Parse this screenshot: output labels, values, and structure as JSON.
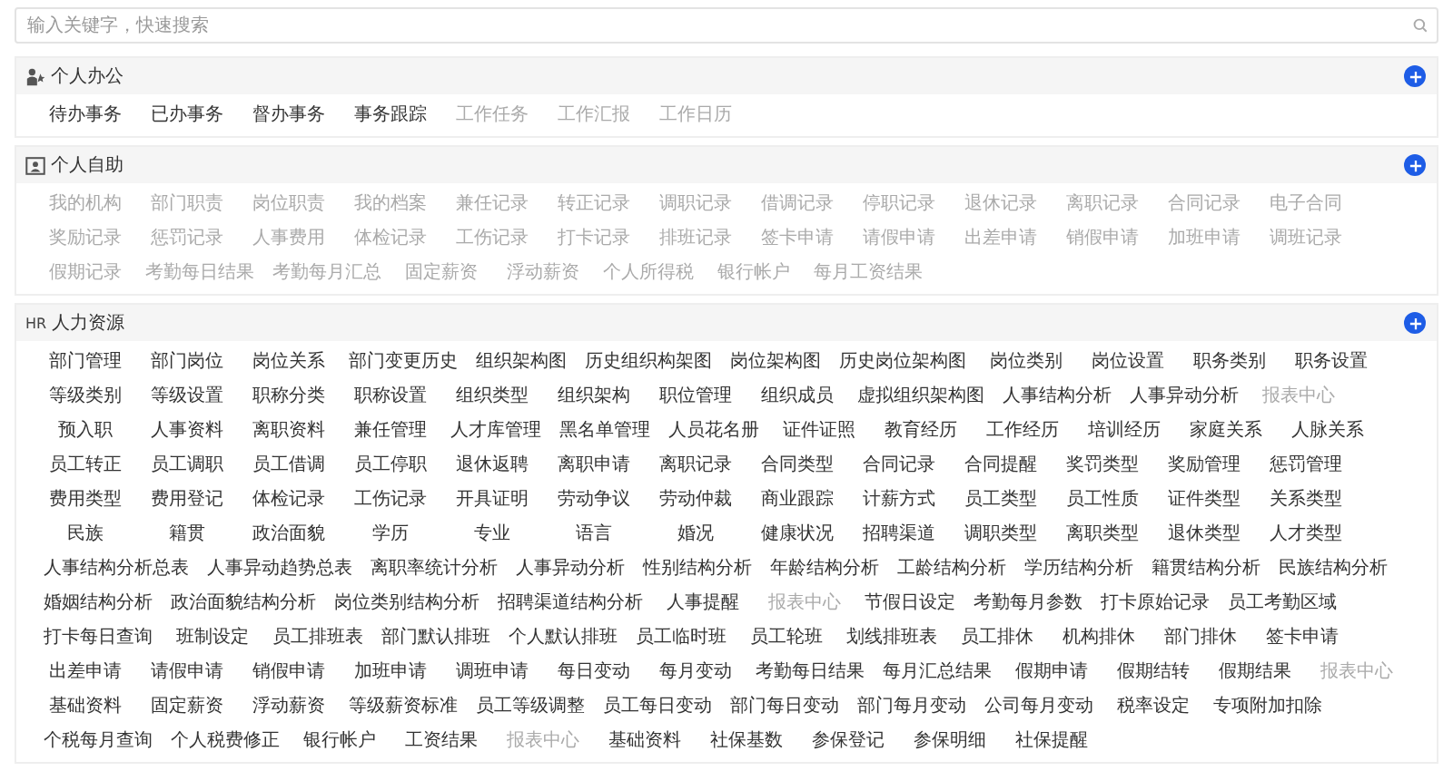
{
  "search": {
    "placeholder": "输入关键字，快速搜索"
  },
  "sections": [
    {
      "title": "个人办公",
      "kind": "person",
      "items": [
        {
          "label": "待办事务",
          "disabled": false
        },
        {
          "label": "已办事务",
          "disabled": false
        },
        {
          "label": "督办事务",
          "disabled": false
        },
        {
          "label": "事务跟踪",
          "disabled": false
        },
        {
          "label": "工作任务",
          "disabled": true
        },
        {
          "label": "工作汇报",
          "disabled": true
        },
        {
          "label": "工作日历",
          "disabled": true
        }
      ]
    },
    {
      "title": "个人自助",
      "kind": "card",
      "items": [
        {
          "label": "我的机构",
          "disabled": true
        },
        {
          "label": "部门职责",
          "disabled": true
        },
        {
          "label": "岗位职责",
          "disabled": true
        },
        {
          "label": "我的档案",
          "disabled": true
        },
        {
          "label": "兼任记录",
          "disabled": true
        },
        {
          "label": "转正记录",
          "disabled": true
        },
        {
          "label": "调职记录",
          "disabled": true
        },
        {
          "label": "借调记录",
          "disabled": true
        },
        {
          "label": "停职记录",
          "disabled": true
        },
        {
          "label": "退休记录",
          "disabled": true
        },
        {
          "label": "离职记录",
          "disabled": true
        },
        {
          "label": "合同记录",
          "disabled": true
        },
        {
          "label": "电子合同",
          "disabled": true
        },
        {
          "label": "奖励记录",
          "disabled": true
        },
        {
          "label": "惩罚记录",
          "disabled": true
        },
        {
          "label": "人事费用",
          "disabled": true
        },
        {
          "label": "体检记录",
          "disabled": true
        },
        {
          "label": "工伤记录",
          "disabled": true
        },
        {
          "label": "打卡记录",
          "disabled": true
        },
        {
          "label": "排班记录",
          "disabled": true
        },
        {
          "label": "签卡申请",
          "disabled": true
        },
        {
          "label": "请假申请",
          "disabled": true
        },
        {
          "label": "出差申请",
          "disabled": true
        },
        {
          "label": "销假申请",
          "disabled": true
        },
        {
          "label": "加班申请",
          "disabled": true
        },
        {
          "label": "调班记录",
          "disabled": true
        },
        {
          "label": "假期记录",
          "disabled": true
        },
        {
          "label": "考勤每日结果",
          "disabled": true
        },
        {
          "label": "考勤每月汇总",
          "disabled": true
        },
        {
          "label": "固定薪资",
          "disabled": true
        },
        {
          "label": "浮动薪资",
          "disabled": true
        },
        {
          "label": "个人所得税",
          "disabled": true
        },
        {
          "label": "银行帐户",
          "disabled": true
        },
        {
          "label": "每月工资结果",
          "disabled": true
        }
      ]
    },
    {
      "title": "人力资源",
      "kind": "text",
      "icon_text": "HR",
      "items": [
        {
          "label": "部门管理",
          "disabled": false
        },
        {
          "label": "部门岗位",
          "disabled": false
        },
        {
          "label": "岗位关系",
          "disabled": false
        },
        {
          "label": "部门变更历史",
          "disabled": false
        },
        {
          "label": "组织架构图",
          "disabled": false
        },
        {
          "label": "历史组织构架图",
          "disabled": false
        },
        {
          "label": "岗位架构图",
          "disabled": false
        },
        {
          "label": "历史岗位架构图",
          "disabled": false
        },
        {
          "label": "岗位类别",
          "disabled": false
        },
        {
          "label": "岗位设置",
          "disabled": false
        },
        {
          "label": "职务类别",
          "disabled": false
        },
        {
          "label": "职务设置",
          "disabled": false
        },
        {
          "label": "等级类别",
          "disabled": false
        },
        {
          "label": "等级设置",
          "disabled": false
        },
        {
          "label": "职称分类",
          "disabled": false
        },
        {
          "label": "职称设置",
          "disabled": false
        },
        {
          "label": "组织类型",
          "disabled": false
        },
        {
          "label": "组织架构",
          "disabled": false
        },
        {
          "label": "职位管理",
          "disabled": false
        },
        {
          "label": "组织成员",
          "disabled": false
        },
        {
          "label": "虚拟组织架构图",
          "disabled": false
        },
        {
          "label": "人事结构分析",
          "disabled": false
        },
        {
          "label": "人事异动分析",
          "disabled": false
        },
        {
          "label": "报表中心",
          "disabled": true
        },
        {
          "label": "预入职",
          "disabled": false
        },
        {
          "label": "人事资料",
          "disabled": false
        },
        {
          "label": "离职资料",
          "disabled": false
        },
        {
          "label": "兼任管理",
          "disabled": false
        },
        {
          "label": "人才库管理",
          "disabled": false
        },
        {
          "label": "黑名单管理",
          "disabled": false
        },
        {
          "label": "人员花名册",
          "disabled": false
        },
        {
          "label": "证件证照",
          "disabled": false
        },
        {
          "label": "教育经历",
          "disabled": false
        },
        {
          "label": "工作经历",
          "disabled": false
        },
        {
          "label": "培训经历",
          "disabled": false
        },
        {
          "label": "家庭关系",
          "disabled": false
        },
        {
          "label": "人脉关系",
          "disabled": false
        },
        {
          "label": "员工转正",
          "disabled": false
        },
        {
          "label": "员工调职",
          "disabled": false
        },
        {
          "label": "员工借调",
          "disabled": false
        },
        {
          "label": "员工停职",
          "disabled": false
        },
        {
          "label": "退休返聘",
          "disabled": false
        },
        {
          "label": "离职申请",
          "disabled": false
        },
        {
          "label": "离职记录",
          "disabled": false
        },
        {
          "label": "合同类型",
          "disabled": false
        },
        {
          "label": "合同记录",
          "disabled": false
        },
        {
          "label": "合同提醒",
          "disabled": false
        },
        {
          "label": "奖罚类型",
          "disabled": false
        },
        {
          "label": "奖励管理",
          "disabled": false
        },
        {
          "label": "惩罚管理",
          "disabled": false
        },
        {
          "label": "费用类型",
          "disabled": false
        },
        {
          "label": "费用登记",
          "disabled": false
        },
        {
          "label": "体检记录",
          "disabled": false
        },
        {
          "label": "工伤记录",
          "disabled": false
        },
        {
          "label": "开具证明",
          "disabled": false
        },
        {
          "label": "劳动争议",
          "disabled": false
        },
        {
          "label": "劳动仲裁",
          "disabled": false
        },
        {
          "label": "商业跟踪",
          "disabled": false
        },
        {
          "label": "计薪方式",
          "disabled": false
        },
        {
          "label": "员工类型",
          "disabled": false
        },
        {
          "label": "员工性质",
          "disabled": false
        },
        {
          "label": "证件类型",
          "disabled": false
        },
        {
          "label": "关系类型",
          "disabled": false
        },
        {
          "label": "民族",
          "disabled": false
        },
        {
          "label": "籍贯",
          "disabled": false
        },
        {
          "label": "政治面貌",
          "disabled": false
        },
        {
          "label": "学历",
          "disabled": false
        },
        {
          "label": "专业",
          "disabled": false
        },
        {
          "label": "语言",
          "disabled": false
        },
        {
          "label": "婚况",
          "disabled": false
        },
        {
          "label": "健康状况",
          "disabled": false
        },
        {
          "label": "招聘渠道",
          "disabled": false
        },
        {
          "label": "调职类型",
          "disabled": false
        },
        {
          "label": "离职类型",
          "disabled": false
        },
        {
          "label": "退休类型",
          "disabled": false
        },
        {
          "label": "人才类型",
          "disabled": false
        },
        {
          "label": "人事结构分析总表",
          "disabled": false
        },
        {
          "label": "人事异动趋势总表",
          "disabled": false
        },
        {
          "label": "离职率统计分析",
          "disabled": false
        },
        {
          "label": "人事异动分析",
          "disabled": false
        },
        {
          "label": "性别结构分析",
          "disabled": false
        },
        {
          "label": "年龄结构分析",
          "disabled": false
        },
        {
          "label": "工龄结构分析",
          "disabled": false
        },
        {
          "label": "学历结构分析",
          "disabled": false
        },
        {
          "label": "籍贯结构分析",
          "disabled": false
        },
        {
          "label": "民族结构分析",
          "disabled": false
        },
        {
          "label": "婚姻结构分析",
          "disabled": false
        },
        {
          "label": "政治面貌结构分析",
          "disabled": false
        },
        {
          "label": "岗位类别结构分析",
          "disabled": false
        },
        {
          "label": "招聘渠道结构分析",
          "disabled": false
        },
        {
          "label": "人事提醒",
          "disabled": false
        },
        {
          "label": "报表中心",
          "disabled": true
        },
        {
          "label": "节假日设定",
          "disabled": false
        },
        {
          "label": "考勤每月参数",
          "disabled": false
        },
        {
          "label": "打卡原始记录",
          "disabled": false
        },
        {
          "label": "员工考勤区域",
          "disabled": false
        },
        {
          "label": "打卡每日查询",
          "disabled": false
        },
        {
          "label": "班制设定",
          "disabled": false
        },
        {
          "label": "员工排班表",
          "disabled": false
        },
        {
          "label": "部门默认排班",
          "disabled": false
        },
        {
          "label": "个人默认排班",
          "disabled": false
        },
        {
          "label": "员工临时班",
          "disabled": false
        },
        {
          "label": "员工轮班",
          "disabled": false
        },
        {
          "label": "划线排班表",
          "disabled": false
        },
        {
          "label": "员工排休",
          "disabled": false
        },
        {
          "label": "机构排休",
          "disabled": false
        },
        {
          "label": "部门排休",
          "disabled": false
        },
        {
          "label": "签卡申请",
          "disabled": false
        },
        {
          "label": "出差申请",
          "disabled": false
        },
        {
          "label": "请假申请",
          "disabled": false
        },
        {
          "label": "销假申请",
          "disabled": false
        },
        {
          "label": "加班申请",
          "disabled": false
        },
        {
          "label": "调班申请",
          "disabled": false
        },
        {
          "label": "每日变动",
          "disabled": false
        },
        {
          "label": "每月变动",
          "disabled": false
        },
        {
          "label": "考勤每日结果",
          "disabled": false
        },
        {
          "label": "每月汇总结果",
          "disabled": false
        },
        {
          "label": "假期申请",
          "disabled": false
        },
        {
          "label": "假期结转",
          "disabled": false
        },
        {
          "label": "假期结果",
          "disabled": false
        },
        {
          "label": "报表中心",
          "disabled": true
        },
        {
          "label": "基础资料",
          "disabled": false
        },
        {
          "label": "固定薪资",
          "disabled": false
        },
        {
          "label": "浮动薪资",
          "disabled": false
        },
        {
          "label": "等级薪资标准",
          "disabled": false
        },
        {
          "label": "员工等级调整",
          "disabled": false
        },
        {
          "label": "员工每日变动",
          "disabled": false
        },
        {
          "label": "部门每日变动",
          "disabled": false
        },
        {
          "label": "部门每月变动",
          "disabled": false
        },
        {
          "label": "公司每月变动",
          "disabled": false
        },
        {
          "label": "税率设定",
          "disabled": false
        },
        {
          "label": "专项附加扣除",
          "disabled": false
        },
        {
          "label": "个税每月查询",
          "disabled": false
        },
        {
          "label": "个人税费修正",
          "disabled": false
        },
        {
          "label": "银行帐户",
          "disabled": false
        },
        {
          "label": "工资结果",
          "disabled": false
        },
        {
          "label": "报表中心",
          "disabled": true
        },
        {
          "label": "基础资料",
          "disabled": false
        },
        {
          "label": "社保基数",
          "disabled": false
        },
        {
          "label": "参保登记",
          "disabled": false
        },
        {
          "label": "参保明细",
          "disabled": false
        },
        {
          "label": "社保提醒",
          "disabled": false
        }
      ]
    }
  ]
}
